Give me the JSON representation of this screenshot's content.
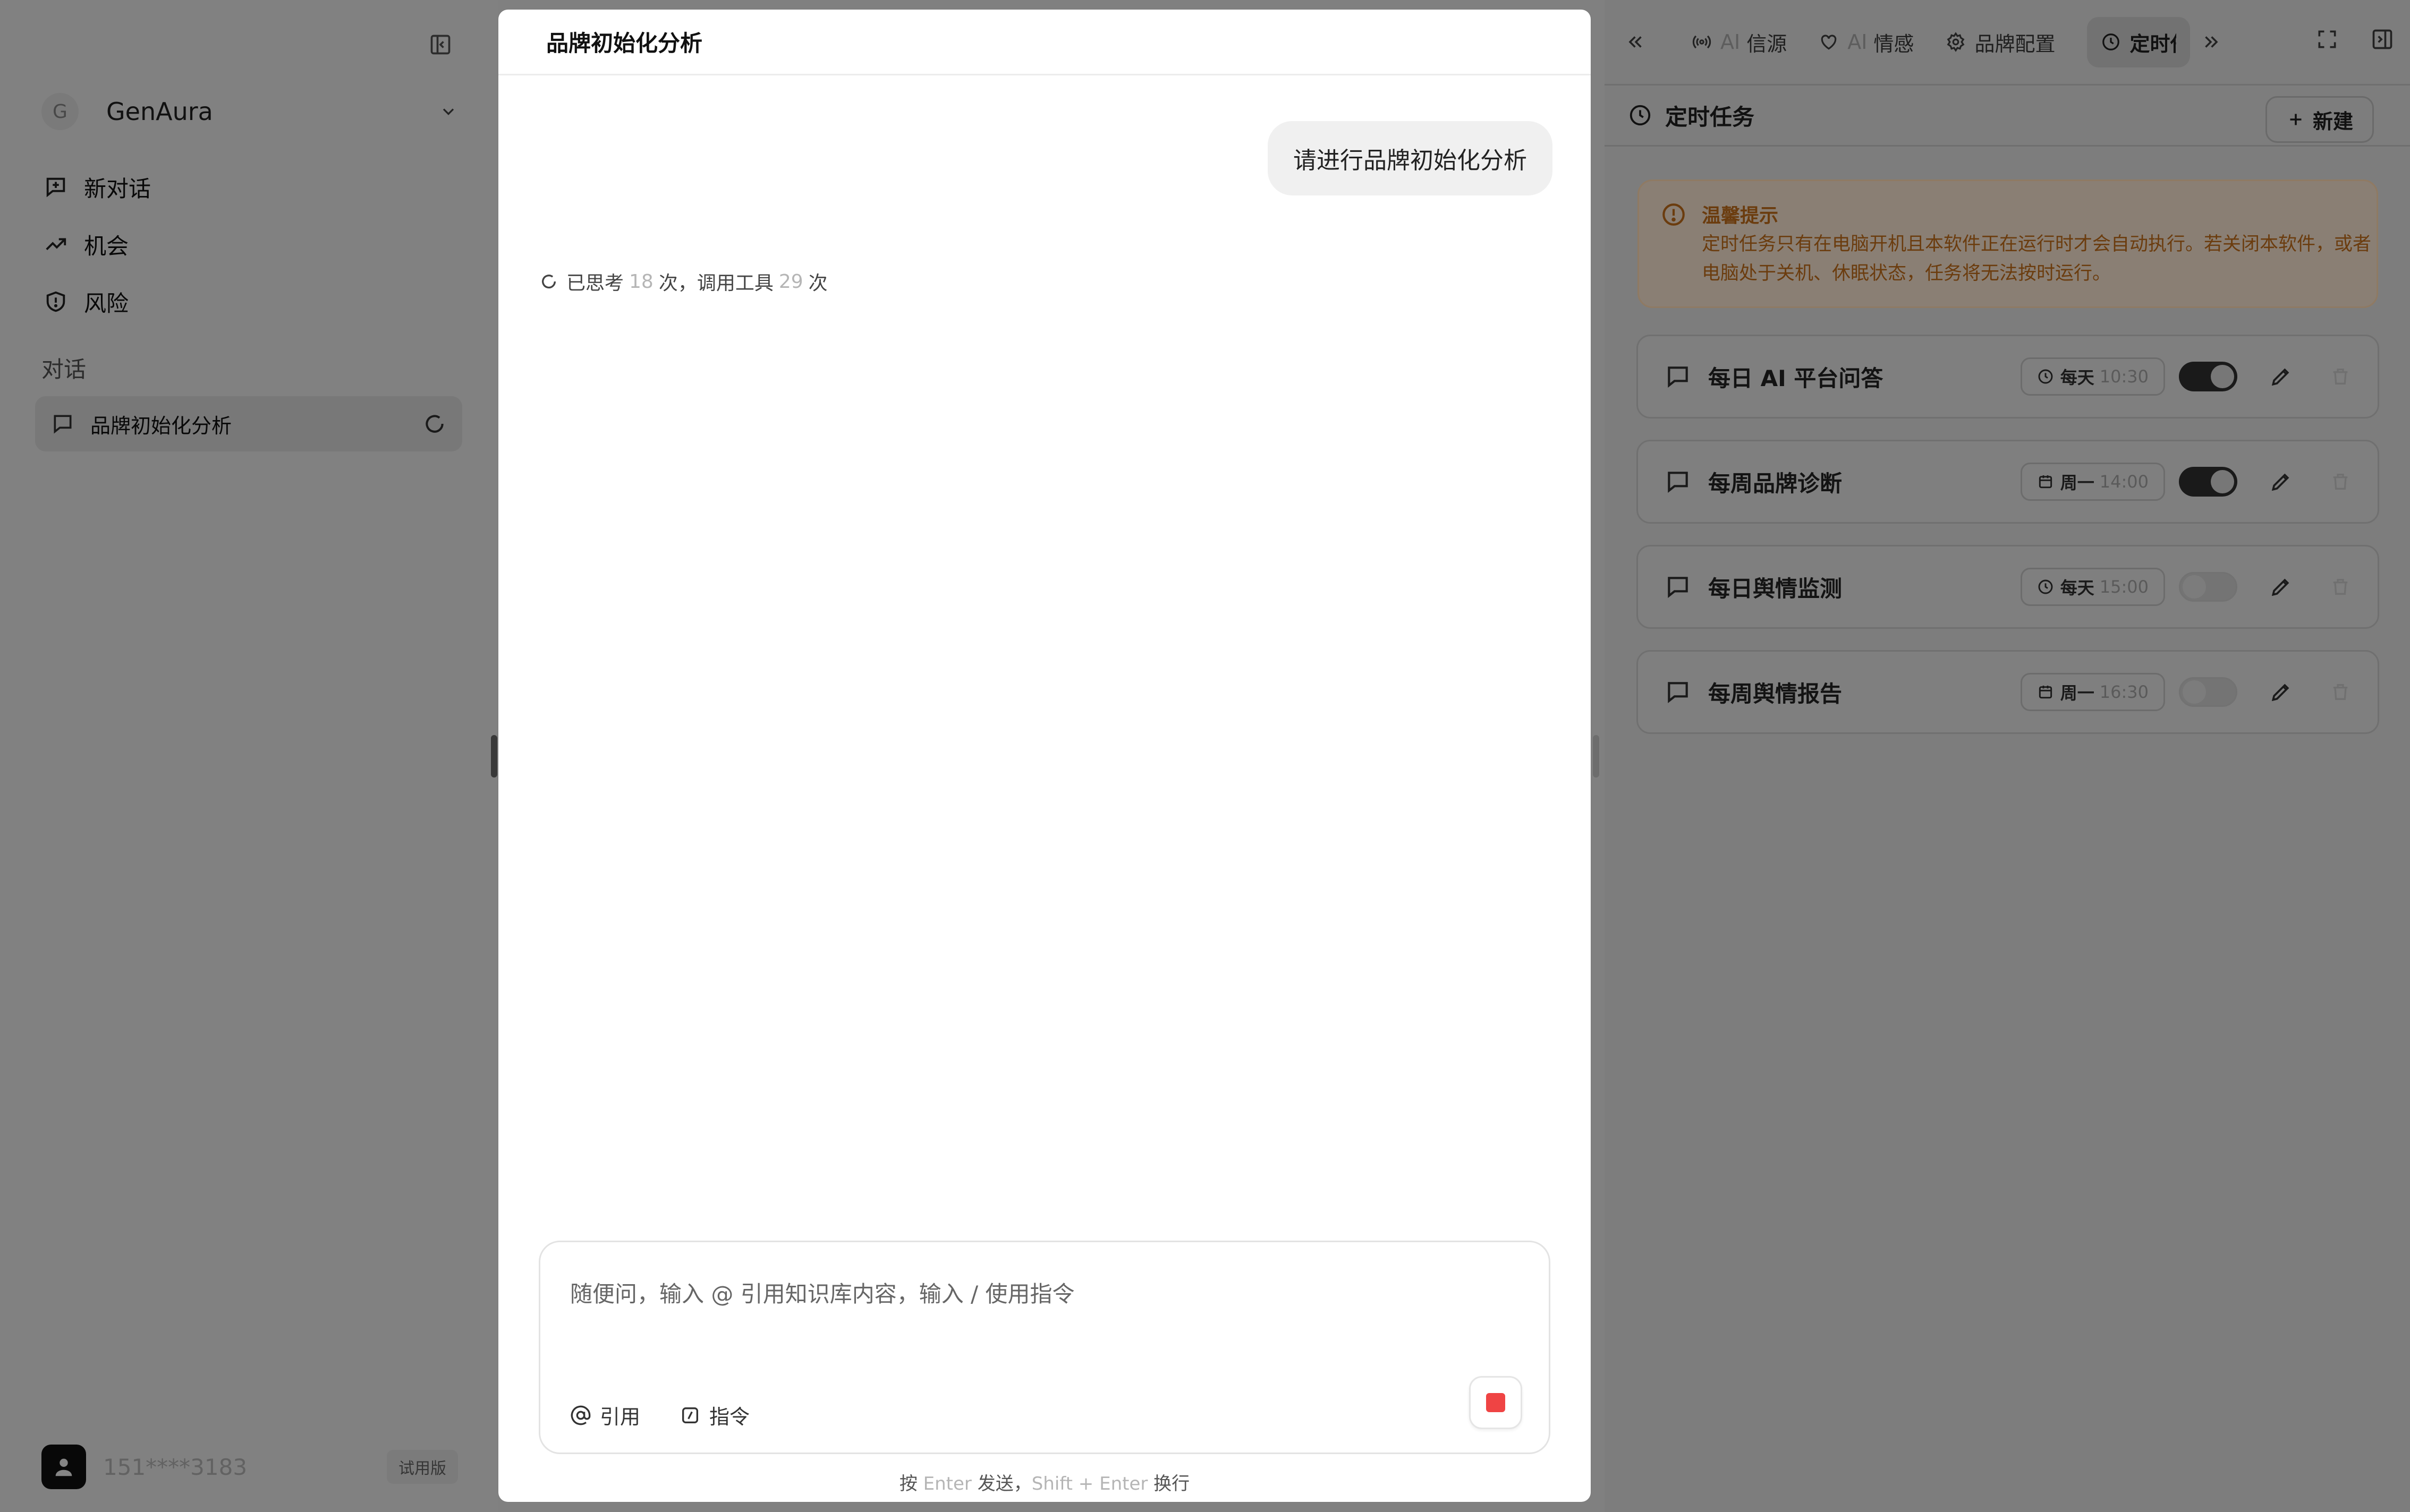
{
  "sidebar": {
    "workspace": {
      "initial": "G",
      "name": "GenAura"
    },
    "nav": [
      {
        "label": "新对话"
      },
      {
        "label": "机会"
      },
      {
        "label": "风险"
      }
    ],
    "section_label": "对话",
    "conversations": [
      {
        "label": "品牌初始化分析"
      }
    ],
    "user": {
      "phone": "151****3183",
      "badge": "试用版"
    }
  },
  "chat": {
    "title": "品牌初始化分析",
    "user_message": "请进行品牌初始化分析",
    "status": {
      "prefix": "已思考",
      "thinks": "18",
      "mid": "次，调用工具",
      "tools": "29",
      "suffix": "次"
    },
    "composer": {
      "placeholder": "随便问，输入 @ 引用知识库内容，输入 / 使用指令",
      "cite_label": "引用",
      "command_label": "指令"
    },
    "hint": {
      "press": "按",
      "enter_key": "Enter",
      "send": "发送，",
      "shift_enter_key": "Shift + Enter",
      "newline": "换行"
    }
  },
  "right_panel": {
    "tabs": [
      {
        "prefix": "AI",
        "label": "信源"
      },
      {
        "prefix": "AI",
        "label": "情感"
      },
      {
        "prefix": "",
        "label": "品牌配置"
      },
      {
        "prefix": "",
        "label": "定时任务",
        "active": true
      }
    ],
    "panel_title": "定时任务",
    "new_button": "新建",
    "notice": {
      "title": "温馨提示",
      "body": "定时任务只有在电脑开机且本软件正在运行时才会自动执行。若关闭本软件，或者电脑处于关机、休眠状态，任务将无法按时运行。"
    },
    "tasks": [
      {
        "name": "每日 AI 平台问答",
        "freq": "每天",
        "time": "10:30",
        "enabled": true,
        "schedule_icon": "clock-icon"
      },
      {
        "name": "每周品牌诊断",
        "freq": "周一",
        "time": "14:00",
        "enabled": true,
        "schedule_icon": "calendar-icon"
      },
      {
        "name": "每日舆情监测",
        "freq": "每天",
        "time": "15:00",
        "enabled": false,
        "schedule_icon": "clock-icon"
      },
      {
        "name": "每周舆情报告",
        "freq": "周一",
        "time": "16:30",
        "enabled": false,
        "schedule_icon": "calendar-icon"
      }
    ]
  },
  "colors": {
    "stop": "#ef4444",
    "notice_text": "#6b3c0e",
    "toggle_on": "#1a1a1a"
  }
}
